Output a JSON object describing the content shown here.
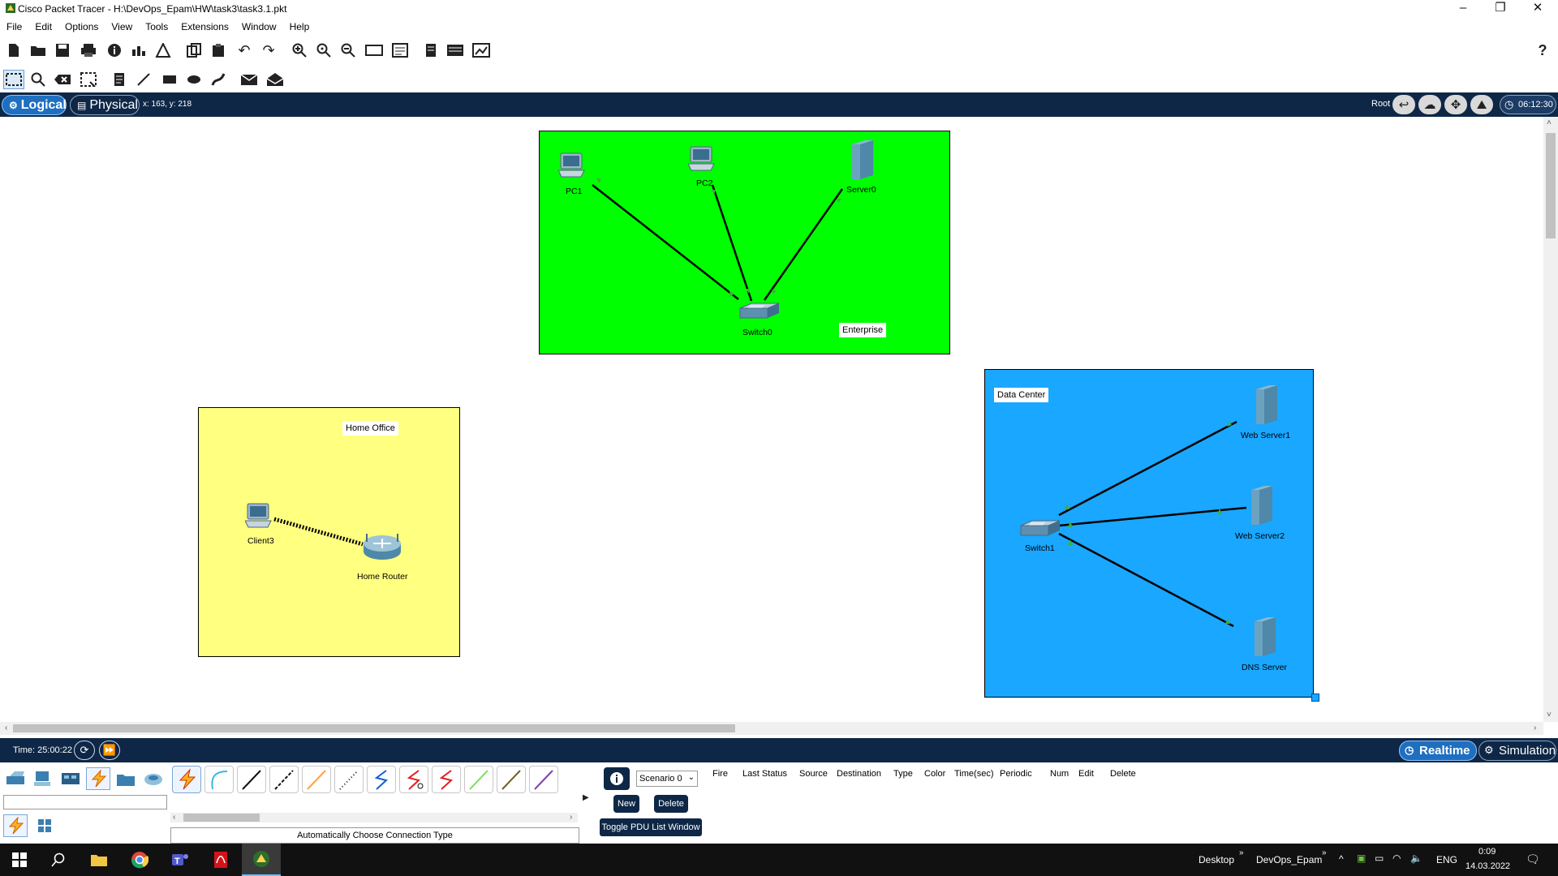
{
  "window": {
    "title": "Cisco Packet Tracer - H:\\DevOps_Epam\\HW\\task3\\task3.1.pkt",
    "controls": [
      "–",
      "❐",
      "✕"
    ]
  },
  "menu": [
    "File",
    "Edit",
    "Options",
    "View",
    "Tools",
    "Extensions",
    "Window",
    "Help"
  ],
  "toolbar": {
    "main_icons": [
      "new-icon",
      "open-icon",
      "save-icon",
      "print-icon",
      "info-icon",
      "network-wizard-icon",
      "activity-wizard-icon",
      "copy-icon",
      "paste-icon",
      "undo-icon",
      "redo-icon",
      "zoom-in-icon",
      "zoom-reset-icon",
      "zoom-out-icon",
      "drawing-palette-icon",
      "custom-devices-icon",
      "view-icon",
      "cluster-icon",
      "ipc-icon"
    ],
    "help": "?",
    "edit_tools": [
      "select-icon",
      "inspect-icon",
      "delete-icon",
      "resize-icon",
      "note-icon",
      "line-icon",
      "rectangle-icon",
      "ellipse-icon",
      "freeform-icon",
      "add-simple-pdu-icon",
      "add-complex-pdu-icon"
    ]
  },
  "view_bar": {
    "logical": "Logical",
    "physical": "Physical",
    "coords": "x: 163, y: 218",
    "root": "Root",
    "clock": "06:12:30"
  },
  "workspace": {
    "areas": [
      {
        "id": "enterprise",
        "label": "Enterprise",
        "color": "#00ff00"
      },
      {
        "id": "home-office",
        "label": "Home Office",
        "color": "#ffff80"
      },
      {
        "id": "data-center",
        "label": "Data Center",
        "color": "#1aa7ff"
      }
    ],
    "devices": {
      "pc1": "PC1",
      "pc2": "PC2",
      "server0": "Server0",
      "switch0": "Switch0",
      "client3": "Client3",
      "home_router": "Home Router",
      "switch1": "Switch1",
      "web_server1": "Web Server1",
      "web_server2": "Web Server2",
      "dns_server": "DNS Server"
    }
  },
  "bottom_bar": {
    "time": "Time: 25:00:22",
    "realtime": "Realtime",
    "simulation": "Simulation"
  },
  "device_panel": {
    "connection_type": "Automatically Choose Connection Type"
  },
  "pdu_panel": {
    "scenario": "Scenario 0",
    "new": "New",
    "delete": "Delete",
    "toggle": "Toggle PDU List Window",
    "columns": [
      "Fire",
      "Last Status",
      "Source",
      "Destination",
      "Type",
      "Color",
      "Time(sec)",
      "Periodic",
      "Num",
      "Edit",
      "Delete"
    ]
  },
  "taskbar": {
    "desktop": "Desktop",
    "folder": "DevOps_Epam",
    "lang": "ENG",
    "time": "0:09",
    "date": "14.03.2022"
  }
}
